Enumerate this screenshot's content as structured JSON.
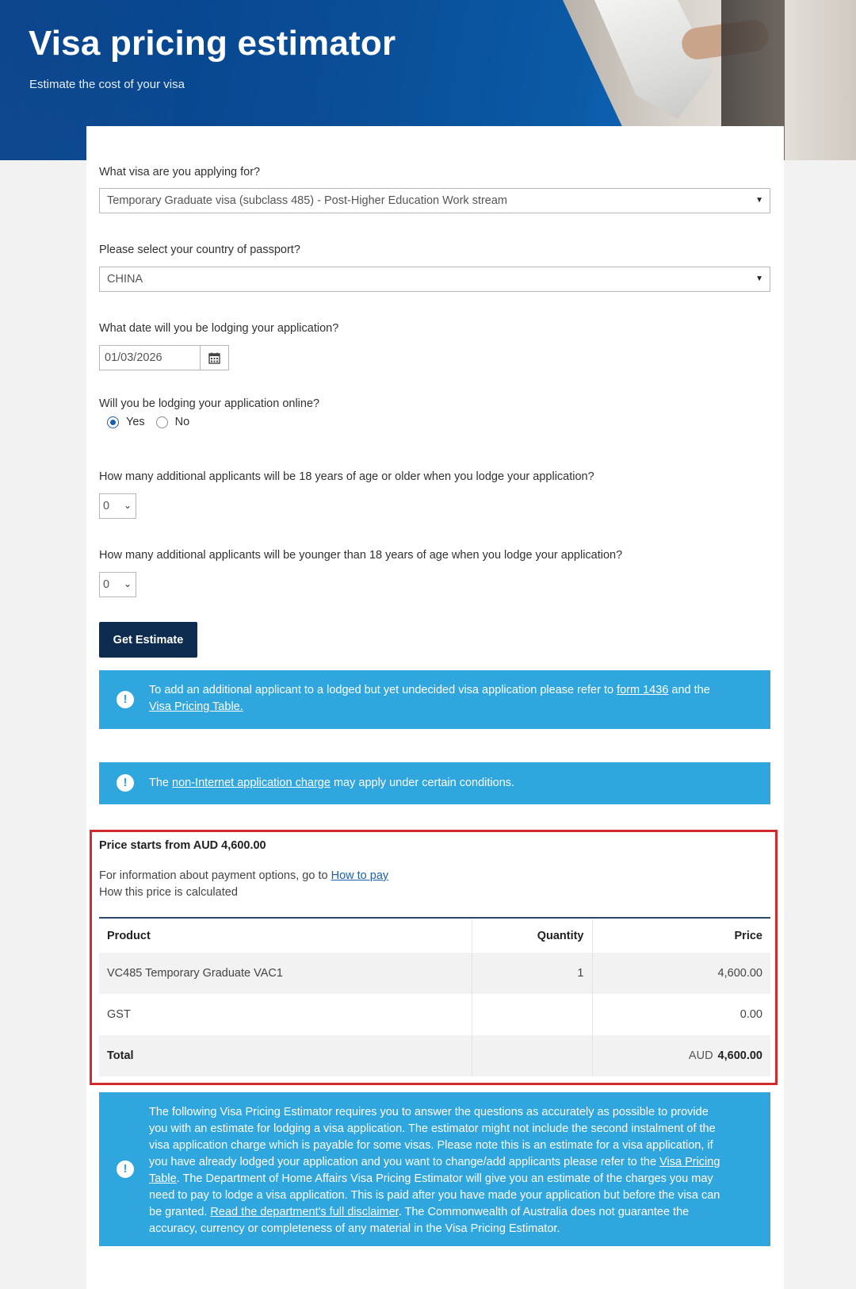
{
  "header": {
    "title": "Visa pricing estimator",
    "subtitle": "Estimate the cost of your visa"
  },
  "form": {
    "visa_question": "What visa are you applying for?",
    "visa_value": "Temporary Graduate visa (subclass 485) - Post-Higher Education Work stream",
    "passport_question": "Please select your country of passport?",
    "passport_value": "CHINA",
    "date_question": "What date will you be lodging your application?",
    "date_value": "01/03/2026",
    "online_question": "Will you be lodging your application online?",
    "online_yes": "Yes",
    "online_no": "No",
    "online_selected": "Yes",
    "adults_question": "How many additional applicants will be 18 years of age or older when you lodge your application?",
    "adults_value": "0",
    "children_question": "How many additional applicants will be younger than 18 years of age when you lodge your application?",
    "children_value": "0",
    "submit_label": "Get Estimate"
  },
  "alerts": {
    "additional": {
      "text_1": "To add an additional applicant to a lodged but yet undecided visa application please refer to ",
      "link_1": "form 1436",
      "text_2": " and the ",
      "link_2": "Visa Pricing Table."
    },
    "non_internet": {
      "text_1": "The ",
      "link_1": "non-Internet application charge",
      "text_2": " may apply under certain conditions."
    },
    "disclaimer": {
      "text_1": "The following Visa Pricing Estimator requires you to answer the questions as accurately as possible to provide you with an estimate for lodging a visa application. The estimator might not include the second instalment of the visa application charge which is payable for some visas. Please note this is an estimate for a visa application, if you have already lodged your application and you want to change/add applicants please refer to the ",
      "link_1": "Visa Pricing Table",
      "text_2": ". The Department of Home Affairs Visa Pricing Estimator will give you an estimate of the charges you may need to pay to lodge a visa application. This is paid after you have made your application but before the visa can be granted. ",
      "link_2": "Read the department's full disclaimer",
      "text_3": ". The Commonwealth of Australia does not guarantee the accuracy, currency or completeness of any material in the Visa Pricing Estimator."
    }
  },
  "result": {
    "price_heading": "Price starts from AUD 4,600.00",
    "payment_text": "For information about payment options, go to ",
    "payment_link": "How to pay",
    "calc_text": "How this price is calculated",
    "columns": [
      "Product",
      "Quantity",
      "Price"
    ],
    "rows": [
      {
        "product": "VC485 Temporary Graduate VAC1",
        "quantity": "1",
        "price": "4,600.00"
      },
      {
        "product": "GST",
        "quantity": "",
        "price": "0.00"
      }
    ],
    "total_label": "Total",
    "total_currency": "AUD",
    "total_value": "4,600.00"
  },
  "colors": {
    "header_blue": "#0a4f98",
    "button_navy": "#0e2c4f",
    "alert_blue": "#2fa6de",
    "highlight_red": "#d12b2b",
    "link_blue": "#1a5fb4"
  },
  "icons": {
    "calendar": "calendar-icon",
    "alert": "exclamation-circle-icon",
    "select_caret": "caret-down-icon",
    "small_select": "chevron-down-icon"
  }
}
